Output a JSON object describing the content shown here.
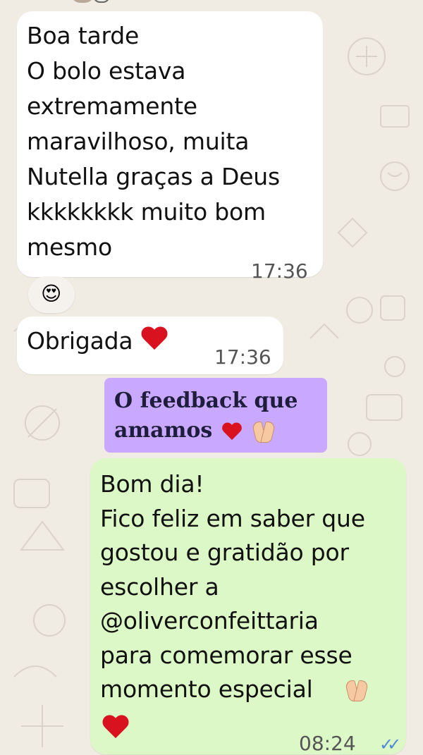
{
  "messages": [
    {
      "direction": "incoming",
      "text": "Boa tarde\nO bolo estava\nextremamente\nmaravilhoso, muita\nNutella graças a Deus\nkkkkkkkk muito bom\nmesmo",
      "time": "17:36"
    },
    {
      "direction": "incoming",
      "text": "Obrigada",
      "time": "17:36"
    },
    {
      "direction": "outgoing",
      "text": "Bom dia!\nFico feliz em saber que\ngostou e gratidão por\nescolher a\n@oliverconfeittaria\npara comemorar esse\nmomento especial",
      "time": "08:24"
    }
  ],
  "reaction": {
    "emoji": "😍"
  },
  "caption": {
    "text": "O feedback que\namamos",
    "background": "#c9a8ff"
  },
  "colors": {
    "incoming_bubble": "#ffffff",
    "outgoing_bubble": "#dcf8c6",
    "wallpaper": "#f0ebe3",
    "read_ticks": "#4a8bd6",
    "heart": "#d9121f"
  },
  "icons": {
    "reaction": "heart-eyes-emoji",
    "heart": "red-heart-emoji",
    "praying": "folded-hands-emoji",
    "read_status": "double-check-icon"
  }
}
